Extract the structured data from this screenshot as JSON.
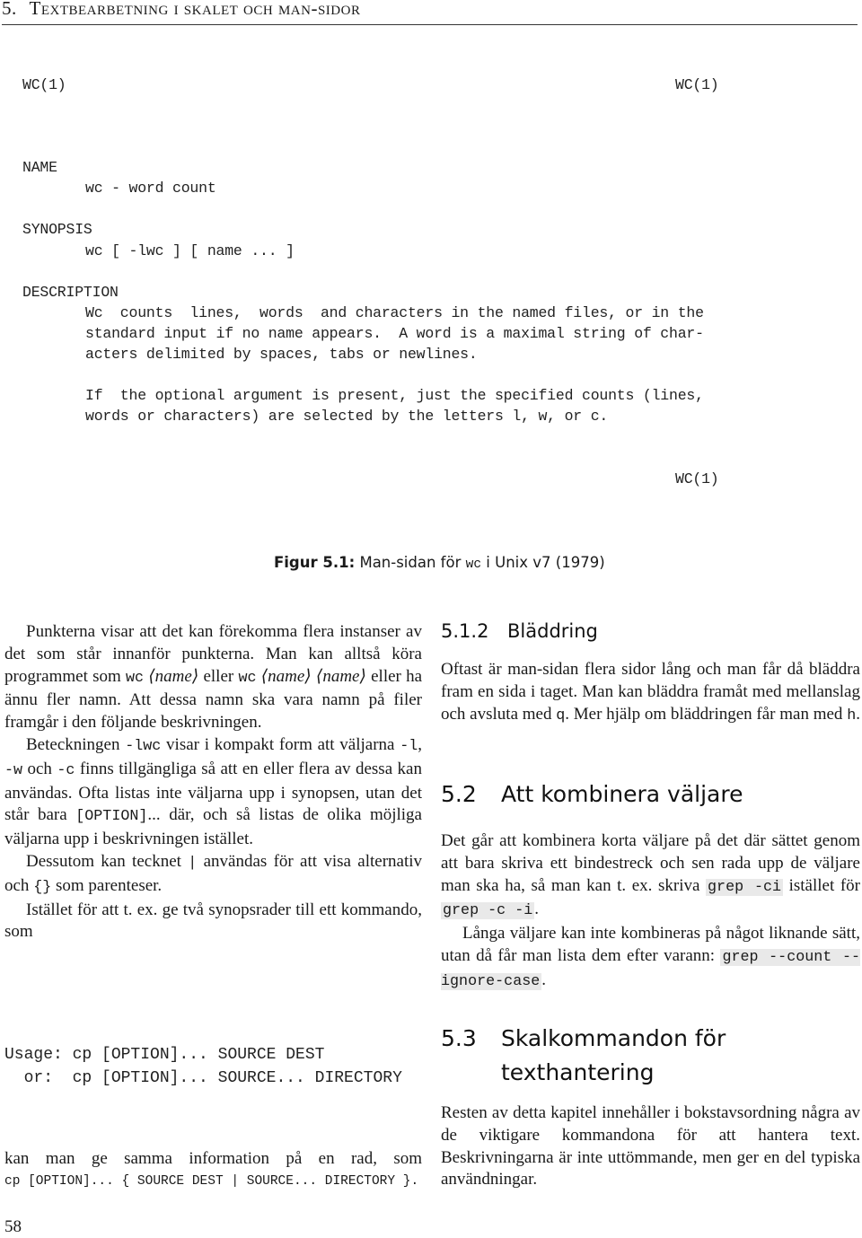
{
  "running_head": {
    "chapter_number": "5.",
    "chapter_title": "Textbearbetning i skalet och man-sidor"
  },
  "figure": {
    "header_left": "WC(1)",
    "header_right": "WC(1)",
    "footer_right": "WC(1)",
    "sections": {
      "name_heading": "NAME",
      "name_text": "wc - word count",
      "synopsis_heading": "SYNOPSIS",
      "synopsis_text": "wc [ -lwc ] [ name ... ]",
      "description_heading": "DESCRIPTION",
      "description_lines": [
        "Wc  counts  lines,  words  and characters in the named files, or in the",
        "standard input if no name appears.  A word is a maximal string of char-",
        "acters delimited by spaces, tabs or newlines.",
        "If  the optional argument is present, just the specified counts (lines,",
        "words or characters) are selected by the letters l, w, or c."
      ]
    },
    "caption_label": "Figur 5.1:",
    "caption_text_before": "Man-sidan för",
    "caption_code": "wc",
    "caption_text_after": "i Unix v7 (1979)"
  },
  "left_column": {
    "p1": {
      "t1": "Punkterna visar att det kan förekomma flera instanser av det som står innanför punkterna. Man kan alltså köra programmet som",
      "code1": "wc",
      "name1": "⟨name⟩",
      "t2": "eller",
      "code2": "wc",
      "name2": "⟨name⟩",
      "name3": "⟨name⟩",
      "t3": "eller ha ännu fler namn. Att dessa namn ska vara namn på filer framgår i den följande beskrivningen."
    },
    "p2": {
      "t1": "Beteckningen",
      "code1": "-lwc",
      "t2": "visar i kompakt form att väljarna",
      "code2": "-l",
      "t3": ",",
      "code3": "-w",
      "t4": "och",
      "code4": "-c",
      "t5": "finns tillgängliga så att en eller flera av dessa kan användas. Ofta listas inte väljarna upp i synopsen, utan det står bara",
      "code5": "[OPTION]",
      "t6": "... där, och så listas de olika möjliga väljarna upp i beskrivningen istället."
    },
    "p3": {
      "t1": "Dessutom kan tecknet",
      "code1": "|",
      "t2": "användas för att visa alternativ och",
      "code2": "{}",
      "t3": "som parenteser."
    },
    "p4": "Istället för att t. ex. ge två synopsrader till ett kommando, som",
    "usage_lines": [
      "Usage: cp [OPTION]... SOURCE DEST",
      "  or:  cp [OPTION]... SOURCE... DIRECTORY"
    ],
    "p5": "kan man ge samma information på en rad, som",
    "p5_code": "cp [OPTION]... { SOURCE DEST | SOURCE... DIRECTORY }."
  },
  "right_column": {
    "s512": {
      "number": "5.1.2",
      "title": "Bläddring",
      "t1": "Oftast är man-sidan flera sidor lång och man får då bläddra fram en sida i taget. Man kan bläddra framåt med mellanslag och avsluta med",
      "code1": "q",
      "t2": ". Mer hjälp om bläddringen får man med",
      "code2": "h",
      "t3": "."
    },
    "s52": {
      "number": "5.2",
      "title": "Att kombinera väljare",
      "p1_t1": "Det går att kombinera korta väljare på det där sättet genom att bara skriva ett bindestreck och sen rada upp de väljare man ska ha, så man kan t. ex. skriva",
      "p1_code1": "grep -ci",
      "p1_t2": "istället för",
      "p1_code2": "grep -c -i",
      "p1_t3": ".",
      "p2_t1": "Långa väljare kan inte kombineras på något liknande sätt, utan då får man lista dem efter varann:",
      "p2_code1": "grep --count --ignore-case",
      "p2_t2": "."
    },
    "s53": {
      "number": "5.3",
      "title_line1": "Skalkommandon för",
      "title_line2": "texthantering",
      "text": "Resten av detta kapitel innehåller i bokstavsordning några av de viktigare kommandona för att hantera text. Beskrivningarna är inte uttömmande, men ger en del typiska användningar."
    }
  },
  "page_number": "58"
}
